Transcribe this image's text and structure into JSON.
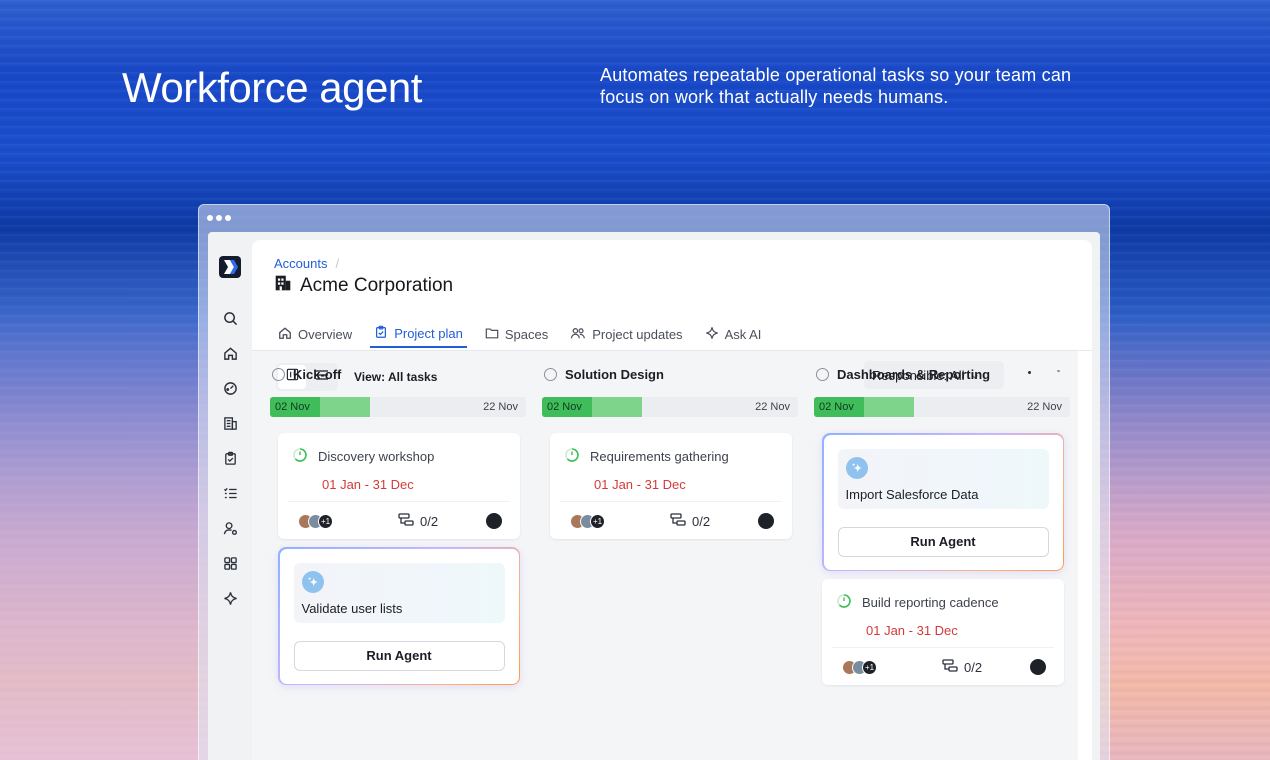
{
  "hero": {
    "title": "Workforce agent",
    "description": "Automates repeatable operational tasks so your team can focus on work that actually needs humans."
  },
  "breadcrumb": {
    "parent": "Accounts",
    "separator": "/"
  },
  "page": {
    "title": "Acme Corporation"
  },
  "tabs": [
    {
      "label": "Overview",
      "icon": "home-icon"
    },
    {
      "label": "Project plan",
      "icon": "clipboard-icon",
      "active": true
    },
    {
      "label": "Spaces",
      "icon": "folder-icon"
    },
    {
      "label": "Project updates",
      "icon": "people-icon"
    },
    {
      "label": "Ask AI",
      "icon": "sparkle-icon"
    }
  ],
  "toolbar": {
    "view_label": "View: All tasks",
    "responsible_label": "Responsible: All"
  },
  "colors": {
    "accent": "#1f5fd6",
    "date_red": "#d43a3a",
    "progress_dark": "#3fbd5a",
    "progress_light": "#7ed48a"
  },
  "columns": [
    {
      "title": "Kick-off",
      "timeline": {
        "start": "02 Nov",
        "end": "22 Nov"
      },
      "task": {
        "title": "Discovery workshop",
        "date": "01 Jan - 31 Dec",
        "extra_assignees": "+1",
        "subtasks": "0/2"
      },
      "agent": {
        "label": "Validate user lists",
        "button": "Run Agent"
      }
    },
    {
      "title": "Solution Design",
      "timeline": {
        "start": "02 Nov",
        "end": "22 Nov"
      },
      "task": {
        "title": "Requirements gathering",
        "date": "01 Jan - 31 Dec",
        "extra_assignees": "+1",
        "subtasks": "0/2"
      }
    },
    {
      "title": "Dashboards & Reporting",
      "timeline": {
        "start": "02 Nov",
        "end": "22 Nov"
      },
      "agent": {
        "label": "Import Salesforce Data",
        "button": "Run Agent"
      },
      "task": {
        "title": "Build reporting cadence",
        "date": "01 Jan - 31 Dec",
        "extra_assignees": "+1",
        "subtasks": "0/2"
      }
    }
  ]
}
